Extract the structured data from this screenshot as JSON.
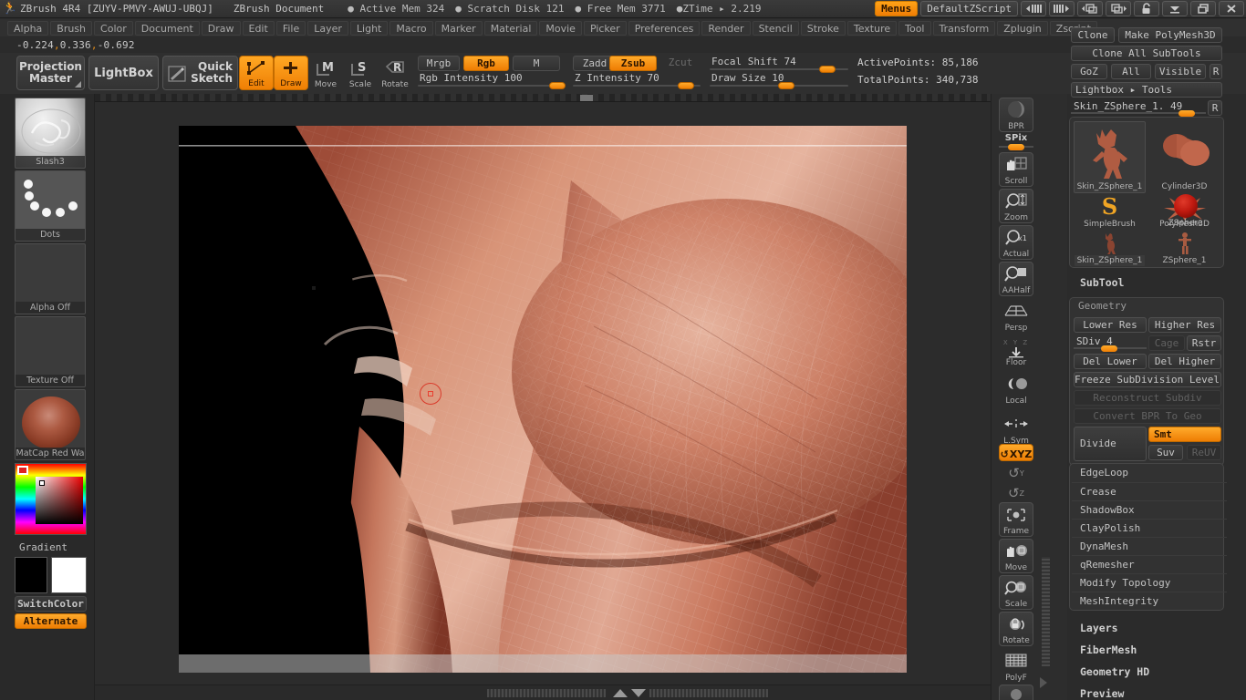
{
  "titlebar": {
    "app_title": "ZBrush 4R4 [ZUYV-PMVY-AWUJ-UBQJ]",
    "document_title": "ZBrush Document",
    "active_mem": "● Active Mem 324",
    "scratch_disk": "● Scratch Disk 121",
    "free_mem": "● Free Mem 3771",
    "ztime": "●ZTime ▸ 2.219",
    "menus_label": "Menus",
    "script_label": "DefaultZScript",
    "icons": {
      "prev_tray": "tray-left-icon",
      "next_tray": "tray-right-icon",
      "prev_window": "window-left-icon",
      "next_window": "window-right-icon",
      "lock": "lock-icon",
      "minimize": "minimize-icon",
      "restore": "restore-icon",
      "close": "close-icon"
    }
  },
  "menubar": {
    "items": [
      "Alpha",
      "Brush",
      "Color",
      "Document",
      "Draw",
      "Edit",
      "File",
      "Layer",
      "Light",
      "Macro",
      "Marker",
      "Material",
      "Movie",
      "Picker",
      "Preferences",
      "Render",
      "Stencil",
      "Stroke",
      "Texture",
      "Tool",
      "Transform",
      "Zplugin",
      "Zscript"
    ]
  },
  "coords": {
    "x": "-0.224",
    "y": "0.336",
    "z": "-0.692"
  },
  "toolbar": {
    "projection_master": "Projection\nMaster",
    "projection_master_line1": "Projection",
    "projection_master_line2": "Master",
    "lightbox": "LightBox",
    "quick_sketch_line1": "Quick",
    "quick_sketch_line2": "Sketch",
    "edit": "Edit",
    "draw": "Draw",
    "move": "Move",
    "scale": "Scale",
    "rotate": "Rotate",
    "mrgb": "Mrgb",
    "rgb": "Rgb",
    "m": "M",
    "zadd": "Zadd",
    "zsub": "Zsub",
    "zcut": "Zcut",
    "rgb_intensity_label": "Rgb Intensity 100",
    "z_intensity_label": "Z Intensity 70",
    "focal_shift_label": "Focal Shift 74",
    "draw_size_label": "Draw Size 10",
    "active_points": "ActivePoints: 85,186",
    "total_points": "TotalPoints: 340,738"
  },
  "left_tray": {
    "brush_caption": "Slash3",
    "stroke_caption": "Dots",
    "alpha_caption": "Alpha Off",
    "texture_caption": "Texture Off",
    "material_caption": "MatCap Red Wa",
    "gradient_label": "Gradient",
    "switch_color_label": "SwitchColor",
    "alternate_label": "Alternate",
    "main_color": "#e02020",
    "secondary_color": "#000000",
    "tertiary_color": "#ffffff"
  },
  "rail": {
    "bpr": "BPR",
    "spix": "SPix",
    "scroll": "Scroll",
    "zoom": "Zoom",
    "actual": "Actual",
    "aahalf": "AAHalf",
    "persp": "Persp",
    "floor": "Floor",
    "floor_axes": "X Y Z",
    "local": "Local",
    "lsym": "L.Sym",
    "xyz": "XYZ",
    "rot_y": "Y-rotate-icon",
    "rot_z": "Z-rotate-icon",
    "frame": "Frame",
    "move": "Move",
    "scale": "Scale",
    "rotate": "Rotate",
    "polyf": "PolyF"
  },
  "right_panel": {
    "clone": "Clone",
    "make_polymesh3d": "Make PolyMesh3D",
    "clone_all_subtools": "Clone All SubTools",
    "goz": "GoZ",
    "all": "All",
    "visible": "Visible",
    "r1": "R",
    "lightbox_tools": "Lightbox ▸ Tools",
    "item_size_label": "Skin_ZSphere_1. 49",
    "item_size_r": "R",
    "tools": [
      {
        "name": "Skin_ZSphere_1",
        "selected": true,
        "icon": "creature-thumb"
      },
      {
        "name": "Cylinder3D",
        "selected": false,
        "icon": "cylinder-thumb"
      },
      {
        "name": "PolyMesh3D",
        "selected": false,
        "icon": "star-thumb"
      },
      {
        "name": "SimpleBrush",
        "selected": false,
        "icon": "simplebrush-thumb"
      },
      {
        "name": "ZSphere",
        "selected": false,
        "icon": "sphere-thumb"
      },
      {
        "name": "Skin_ZSphere_1",
        "selected": true,
        "icon": "creature-thumb"
      },
      {
        "name": "ZSphere_1",
        "selected": false,
        "icon": "zsphere-fig-thumb"
      }
    ],
    "subtool_header": "SubTool",
    "geometry_header": "Geometry",
    "lower_res": "Lower Res",
    "higher_res": "Higher Res",
    "sdiv_label": "SDiv 4",
    "cage": "Cage",
    "rstr": "Rstr",
    "del_lower": "Del Lower",
    "del_higher": "Del Higher",
    "freeze_subdivision": "Freeze SubDivision Levels",
    "reconstruct_subdiv": "Reconstruct Subdiv",
    "convert_bpr": "Convert BPR To Geo",
    "divide": "Divide",
    "smt": "Smt",
    "suv": "Suv",
    "reuv": "ReUV",
    "sections": [
      "EdgeLoop",
      "Crease",
      "ShadowBox",
      "ClayPolish",
      "DynaMesh",
      "qRemesher",
      "Modify Topology",
      "MeshIntegrity"
    ],
    "palettes": [
      "Layers",
      "FiberMesh",
      "Geometry HD",
      "Preview"
    ]
  },
  "colors": {
    "accent_orange": "#ef7f04",
    "panel_bg": "#2b2b2b",
    "button_bg": "#3a3a3a",
    "text": "#c6c6c6",
    "model_skin": "#c87a62"
  }
}
